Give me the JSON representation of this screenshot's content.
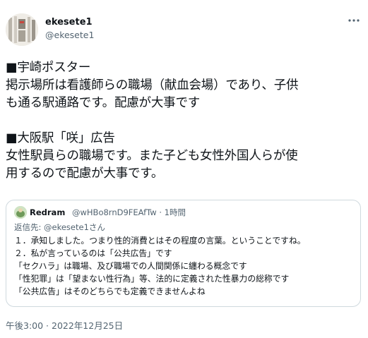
{
  "author": {
    "display_name": "ekesete1",
    "handle": "@ekesete1"
  },
  "tweet": {
    "lines": [
      "■宇崎ポスター",
      "掲示場所は看護師らの職場（献血会場）であり、子供",
      "も通る駅通路です。配慮が大事です",
      "",
      "■大阪駅「咲」広告",
      "女性駅員らの職場です。また子ども女性外国人らが使",
      "用するので配慮が大事です。"
    ],
    "timestamp": "午後3:00 · 2022年12月25日"
  },
  "quote": {
    "display_name": "Redram",
    "meta": "@wHBo8rnD9FEAfTw · 1時間",
    "reply_to": "返信先: @ekesete1さん",
    "lines": [
      "１．承知しました。つまり性的消費とはその程度の言葉。ということですね。",
      "２．私が言っているのは「公共広告」です",
      "「セクハラ」は職場、及び職場での人間関係に纏わる概念です",
      "「性犯罪」は「望まない性行為」等、法的に定義された性暴力の総称です",
      "「公共広告」はそのどちらでも定義できませんよね"
    ]
  },
  "icons": {
    "more": "more-horizontal-icon"
  }
}
